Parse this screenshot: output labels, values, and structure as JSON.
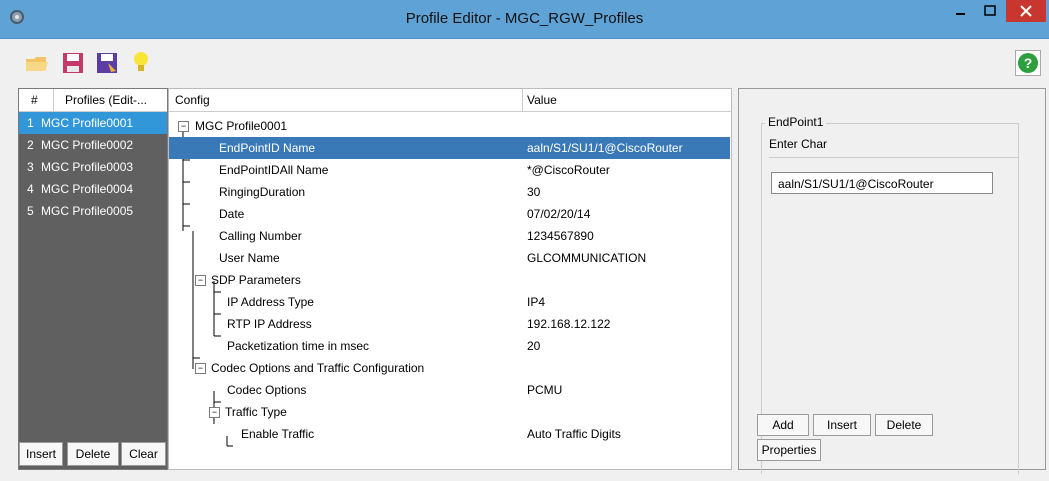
{
  "window": {
    "title": "Profile Editor - MGC_RGW_Profiles",
    "controls": {
      "minimize": "–",
      "maximize": "□",
      "close": "×"
    }
  },
  "toolbar": {
    "icons": [
      "open-folder-icon",
      "save-icon",
      "save-as-icon",
      "idea-bulb-icon"
    ],
    "help_icon": "?"
  },
  "profiles": {
    "header_num": "#",
    "header_name": "Profiles (Edit-...",
    "items": [
      {
        "num": "1",
        "name": "MGC Profile0001",
        "selected": true
      },
      {
        "num": "2",
        "name": "MGC Profile0002"
      },
      {
        "num": "3",
        "name": "MGC Profile0003"
      },
      {
        "num": "4",
        "name": "MGC Profile0004"
      },
      {
        "num": "5",
        "name": "MGC Profile0005"
      }
    ],
    "buttons": {
      "insert": "Insert",
      "delete": "Delete",
      "clear": "Clear"
    }
  },
  "config": {
    "header_config": "Config",
    "header_value": "Value",
    "root": "MGC Profile0001",
    "rows": [
      {
        "name": "EndPointID Name",
        "value": "aaln/S1/SU1/1@CiscoRouter"
      },
      {
        "name": "EndPointIDAll Name",
        "value": "*@CiscoRouter"
      },
      {
        "name": "RingingDuration",
        "value": "30"
      },
      {
        "name": "Date",
        "value": "07/02/20/14"
      },
      {
        "name": "Calling Number",
        "value": "1234567890"
      },
      {
        "name": "User Name",
        "value": "GLCOMMUNICATION"
      },
      {
        "name": "SDP Parameters",
        "value": ""
      },
      {
        "name": "IP Address Type",
        "value": "IP4"
      },
      {
        "name": "RTP IP Address",
        "value": "192.168.12.122"
      },
      {
        "name": "Packetization time in msec",
        "value": "20"
      },
      {
        "name": "Codec Options and Traffic Configuration",
        "value": ""
      },
      {
        "name": "Codec Options",
        "value": "PCMU"
      },
      {
        "name": "Traffic Type",
        "value": ""
      },
      {
        "name": "Enable Traffic",
        "value": "Auto Traffic Digits"
      }
    ]
  },
  "editor": {
    "group_title": "EndPoint1",
    "hint": "Enter Char",
    "value": "aaln/S1/SU1/1@CiscoRouter",
    "buttons": {
      "add": "Add",
      "insert": "Insert",
      "delete": "Delete",
      "properties": "Properties"
    }
  }
}
